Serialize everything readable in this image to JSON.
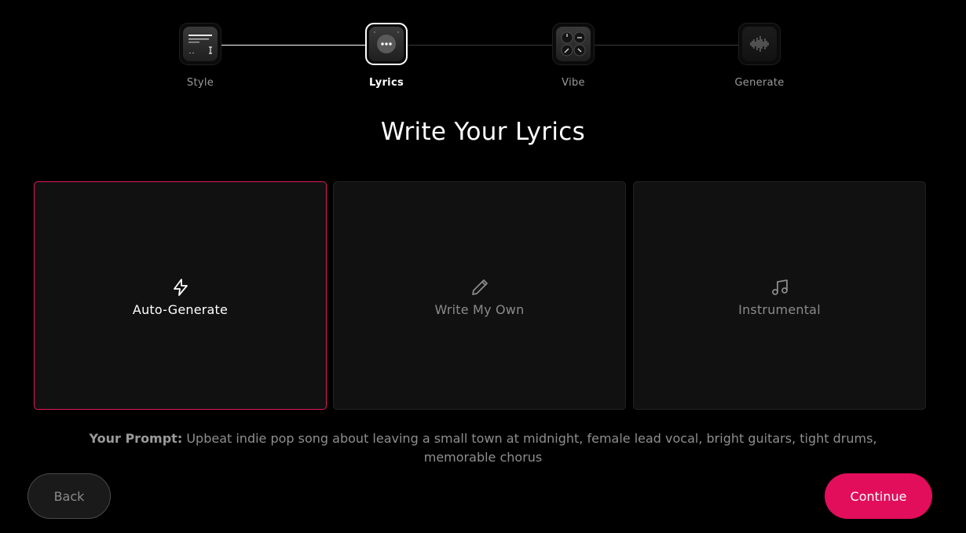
{
  "stepper": {
    "steps": [
      {
        "label": "Style",
        "icon": "text-lines-icon",
        "active": false
      },
      {
        "label": "Lyrics",
        "icon": "chat-bubble-icon",
        "active": true
      },
      {
        "label": "Vibe",
        "icon": "knobs-icon",
        "active": false
      },
      {
        "label": "Generate",
        "icon": "waveform-icon",
        "active": false
      }
    ]
  },
  "main": {
    "title": "Write Your Lyrics",
    "options": [
      {
        "label": "Auto-Generate",
        "icon": "lightning-bolt-icon",
        "selected": true
      },
      {
        "label": "Write My Own",
        "icon": "pencil-icon",
        "selected": false
      },
      {
        "label": "Instrumental",
        "icon": "music-note-icon",
        "selected": false
      }
    ],
    "prompt_label": "Your Prompt:",
    "prompt_text": "Upbeat indie pop song about leaving a small town at midnight, female lead vocal, bright guitars, tight drums, memorable chorus"
  },
  "footer": {
    "back_label": "Back",
    "continue_label": "Continue"
  },
  "colors": {
    "accent": "#e20d5b",
    "selected_border": "#e0195a",
    "card_bg": "#111112",
    "page_bg": "#000000"
  }
}
